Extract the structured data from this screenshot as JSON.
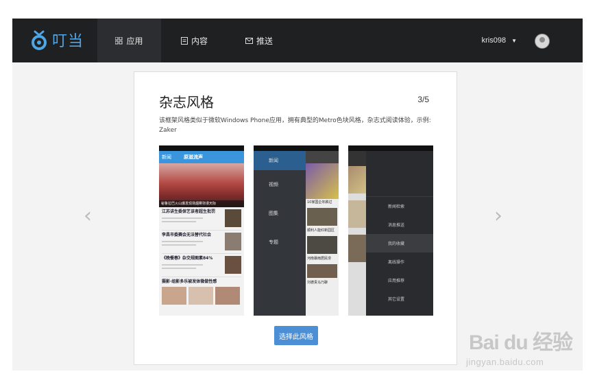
{
  "brand": {
    "name": "叮当"
  },
  "nav": [
    {
      "label": "应用",
      "icon": "grid-icon",
      "active": true
    },
    {
      "label": "内容",
      "icon": "document-icon",
      "active": false
    },
    {
      "label": "推送",
      "icon": "mail-icon",
      "active": false
    }
  ],
  "user": {
    "name": "kris098"
  },
  "card": {
    "title": "杂志风格",
    "counter": "3/5",
    "description": "该框架风格类似于微软Windows Phone应用，拥有典型的Metro色块风格，杂志式阅读体验，示例: Zaker",
    "select_button": "选择此风格"
  },
  "screens": {
    "shot1": {
      "header_left": "新闻",
      "header_title": "原滋流声",
      "headline_caption": "秘鲁拉巴火山爆发现场烟雾弥漫天际",
      "items": [
        "江苏讲生委保艺该者超生批罚",
        "李昌市委赛会无法替代社会",
        "《晚餐春》杂交规图素84%",
        "摄影·组影多乐被发体微做性感"
      ]
    },
    "shot2": {
      "menu": [
        "新闻",
        "视频",
        "图集",
        "专题"
      ],
      "items": [
        "10家国企年薪过",
        "顺利人能红新园区",
        "河南暴雨居民涝",
        "刘德贵马乃聊"
      ]
    },
    "shot3": {
      "menu": [
        "新闻检索",
        "消息推送",
        "我的收藏",
        "离线操作",
        "应用推荐",
        "其它设置"
      ]
    }
  },
  "watermark": {
    "main": "Bai du 经验",
    "sub": "jingyan.baidu.com"
  },
  "colors": {
    "topbar": "#1f2022",
    "accent": "#4c8fd5",
    "logo": "#4fa6e6"
  }
}
